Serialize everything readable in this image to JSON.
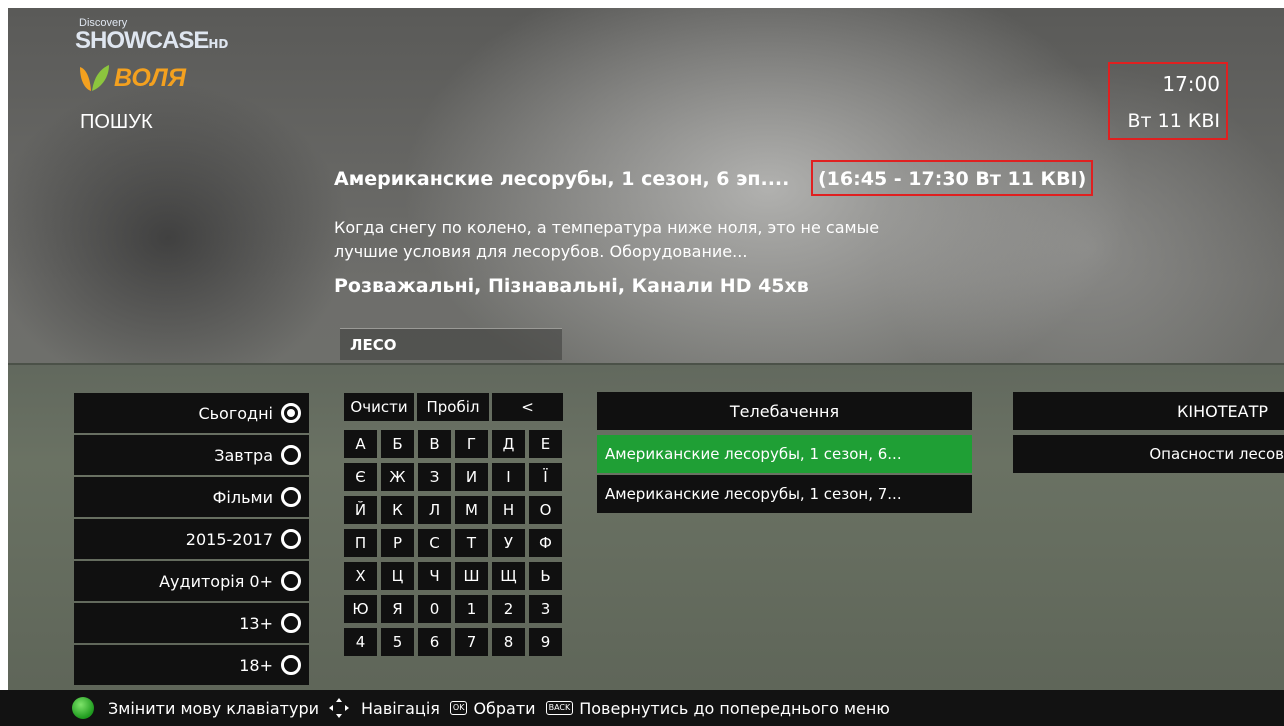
{
  "header": {
    "channel_logo_small": "Discovery",
    "channel_logo_main": "SHOWCASE",
    "channel_logo_hd": "HD",
    "provider_logo_text": "ВОЛЯ",
    "page_title": "ПОШУК"
  },
  "clock": {
    "time": "17:00",
    "date": "Вт 11 КВІ"
  },
  "program": {
    "title": "Американские лесорубы, 1 сезон, 6 эп....",
    "time_range": "(16:45 - 17:30 Вт 11 КВІ)",
    "description": "Когда снегу по колено, а температура ниже ноля, это не самые лучшие условия для лесорубов. Оборудование...",
    "genre_duration": "Розважальні, Пізнавальні, Канали HD  45хв"
  },
  "search": {
    "query": "ЛЕСО"
  },
  "filters": [
    {
      "label": "Сьогодні",
      "selected": true
    },
    {
      "label": "Завтра",
      "selected": false
    },
    {
      "label": "Фільми",
      "selected": false
    },
    {
      "label": "2015-2017",
      "selected": false
    },
    {
      "label": "Аудиторія 0+",
      "selected": false
    },
    {
      "label": "13+",
      "selected": false
    },
    {
      "label": "18+",
      "selected": false
    }
  ],
  "keyboard": {
    "clear_label": "Очисти",
    "space_label": "Пробіл",
    "backspace_label": "<",
    "keys": [
      "А",
      "Б",
      "В",
      "Г",
      "Д",
      "Е",
      "Є",
      "Ж",
      "З",
      "И",
      "І",
      "Ї",
      "Й",
      "К",
      "Л",
      "М",
      "Н",
      "О",
      "П",
      "Р",
      "С",
      "Т",
      "У",
      "Ф",
      "Х",
      "Ц",
      "Ч",
      "Ш",
      "Щ",
      "Ь",
      "Ю",
      "Я",
      "0",
      "1",
      "2",
      "3",
      "4",
      "5",
      "6",
      "7",
      "8",
      "9"
    ]
  },
  "results": {
    "tv_header": "Телебачення",
    "tv_items": [
      "Американские лесорубы, 1 сезон, 6...",
      "Американские лесорубы, 1 сезон, 7..."
    ],
    "cinema_header": "КІНОТЕАТР",
    "cinema_items": [
      "Опасности лесов"
    ]
  },
  "help_bar": {
    "change_lang": "Змінити мову клавіатури",
    "navigation": "Навігація",
    "ok_key": "OK",
    "select": "Обрати",
    "back_key": "BACK",
    "back": "Повернутись до попереднього меню"
  },
  "colors": {
    "highlight": "#1f9f35",
    "callout": "#e02020",
    "provider_orange": "#f4a11f"
  }
}
